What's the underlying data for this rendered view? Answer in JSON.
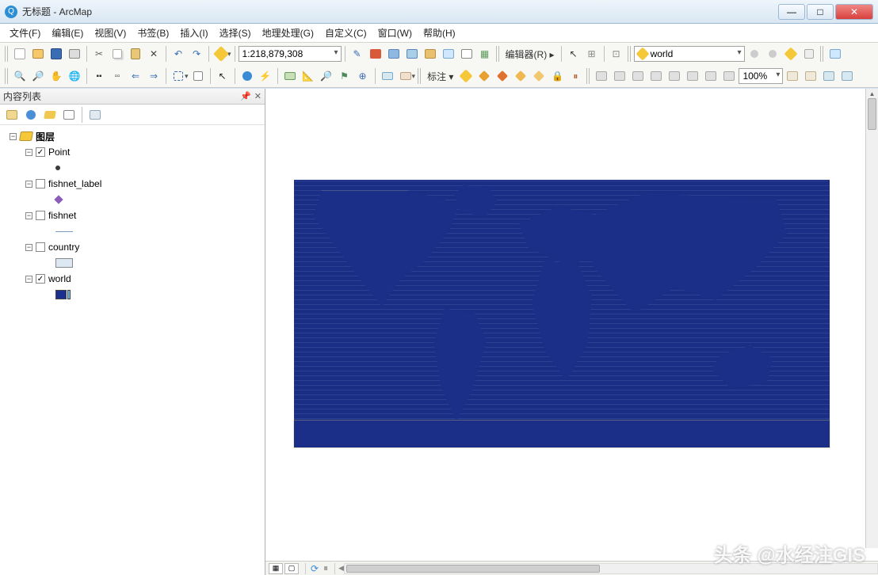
{
  "window": {
    "title": "无标题 - ArcMap",
    "min": "—",
    "max": "□",
    "close": "✕"
  },
  "menu": {
    "file": "文件(F)",
    "edit": "编辑(E)",
    "view": "视图(V)",
    "bookmarks": "书签(B)",
    "insert": "插入(I)",
    "selection": "选择(S)",
    "geoprocessing": "地理处理(G)",
    "customize": "自定义(C)",
    "windows": "窗口(W)",
    "help": "帮助(H)"
  },
  "toolbar": {
    "scale": "1:218,879,308",
    "editor_label": "编辑器(R)",
    "editor_arrow": "▸",
    "target_layer": "world",
    "label_tool": "标注",
    "zoom_pct": "100%"
  },
  "toc": {
    "title": "内容列表",
    "pin": "📌",
    "close": "✕",
    "root": "图层",
    "layers": [
      {
        "name": "Point",
        "checked": true,
        "symbol": "point"
      },
      {
        "name": "fishnet_label",
        "checked": false,
        "symbol": "diamond"
      },
      {
        "name": "fishnet",
        "checked": false,
        "symbol": "line"
      },
      {
        "name": "country",
        "checked": false,
        "symbol": "fill"
      },
      {
        "name": "world",
        "checked": true,
        "symbol": "world"
      }
    ]
  },
  "statusbar": {
    "refresh": "⟳"
  },
  "watermark": "头条 @水经注GIS"
}
